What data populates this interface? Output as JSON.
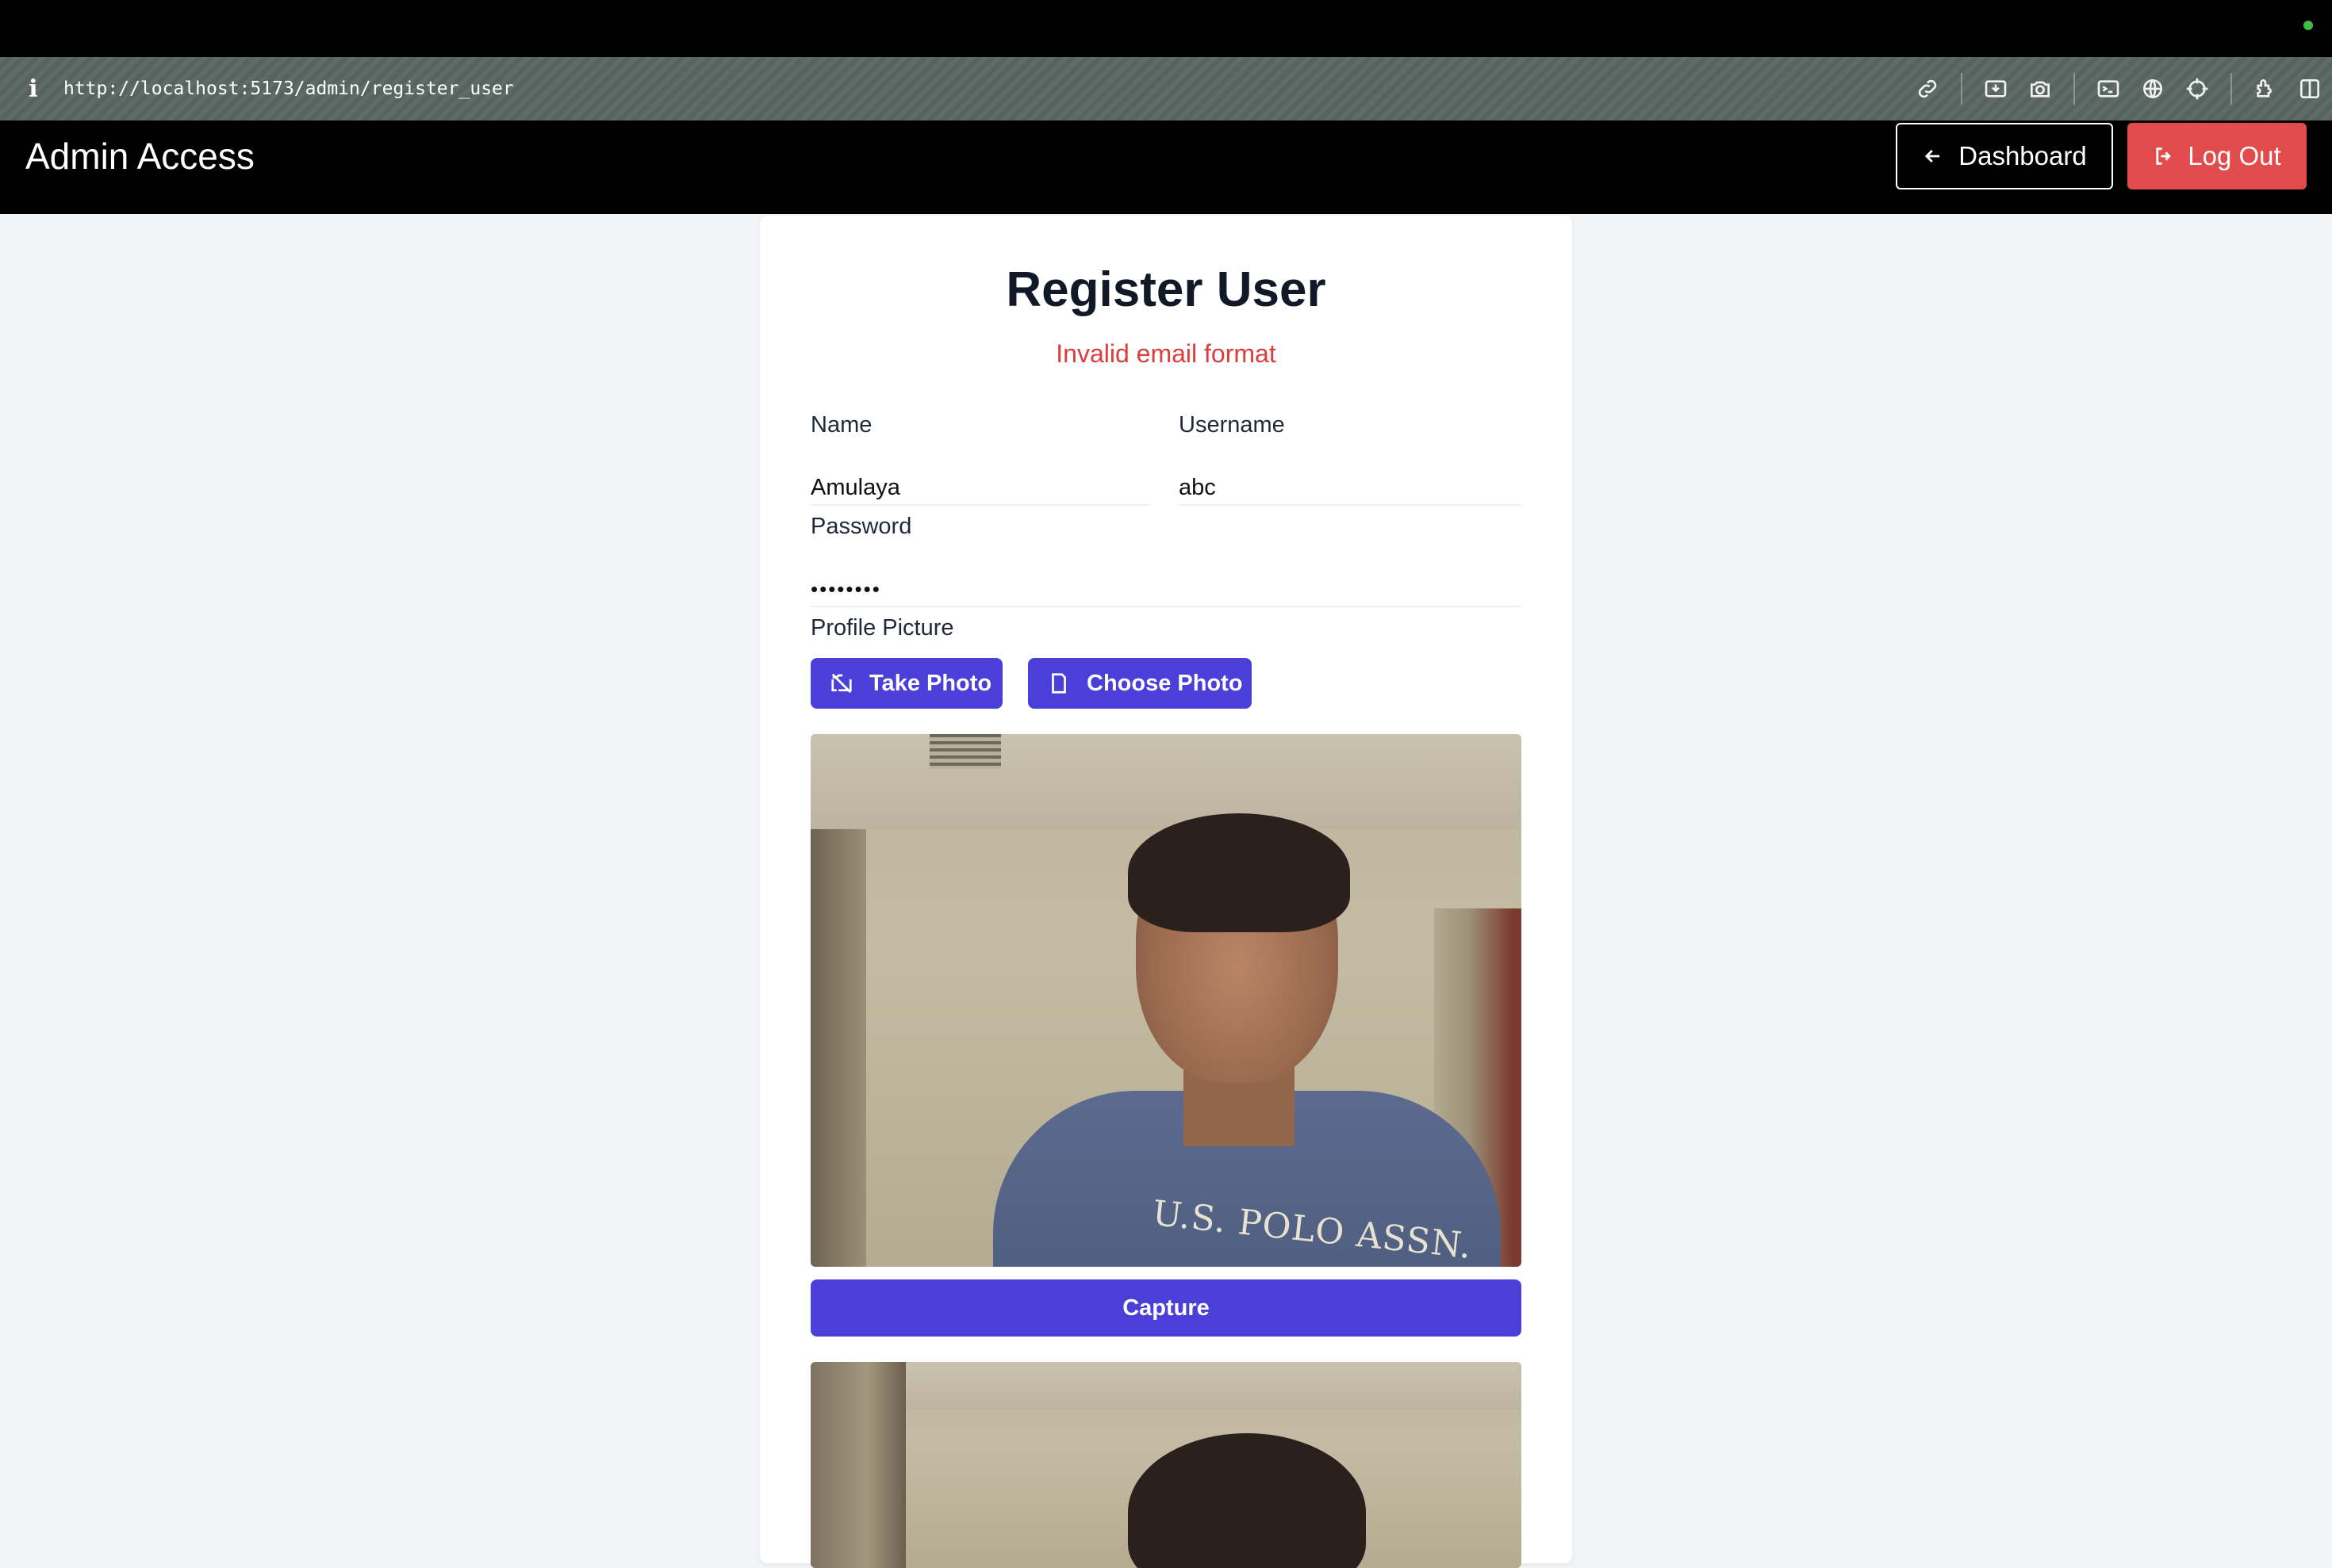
{
  "browser": {
    "url": "http://localhost:5173/admin/register_user",
    "tools": [
      "link-icon",
      "download-icon",
      "camera-icon",
      "terminal-icon",
      "globe-icon",
      "crosshair-icon",
      "extensions-icon",
      "sidebar-icon"
    ]
  },
  "header": {
    "title": "Admin Access",
    "dashboard_label": "Dashboard",
    "logout_label": "Log Out",
    "logout_color": "#e14b4b"
  },
  "form": {
    "title": "Register User",
    "error": "Invalid email format",
    "error_color": "#dc3c3c",
    "name_label": "Name",
    "name_value": "Amulaya",
    "username_label": "Username",
    "username_value": "abc",
    "password_label": "Password",
    "password_value": "••••••••",
    "picture_label": "Profile Picture",
    "take_photo_label": "Take Photo",
    "choose_photo_label": "Choose Photo",
    "capture_label": "Capture",
    "accent_color": "#4a3fd9"
  },
  "camera": {
    "shirt_text": "U.S. POLO ASSN."
  }
}
